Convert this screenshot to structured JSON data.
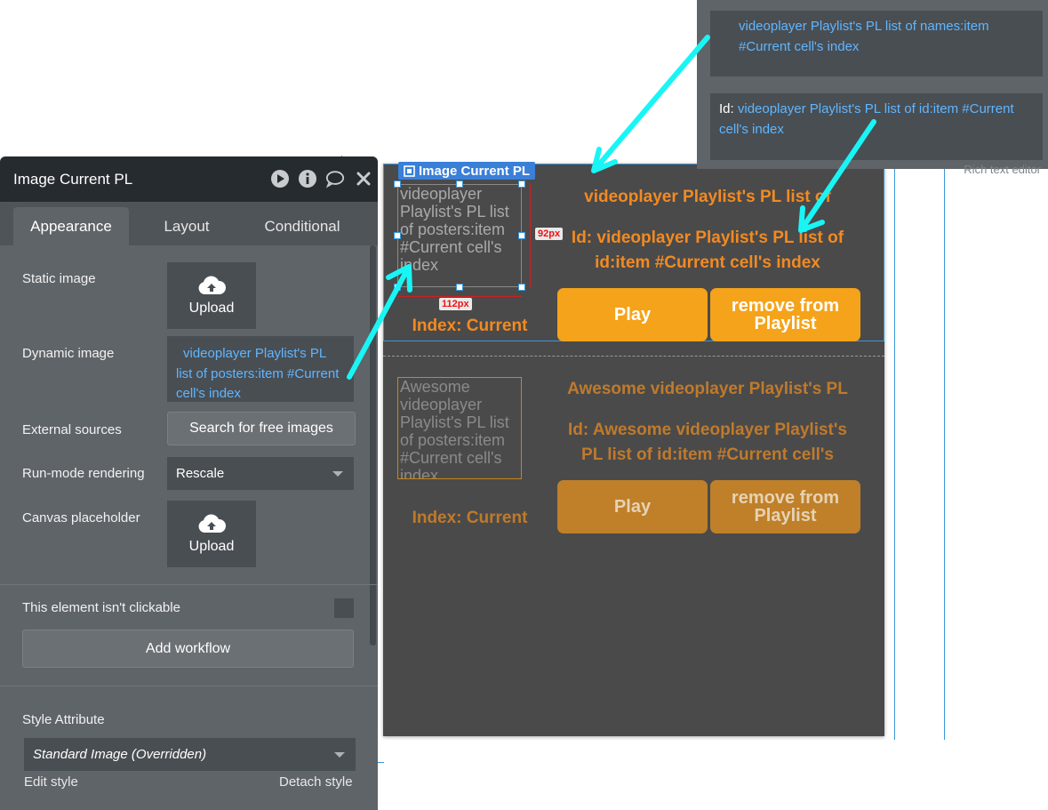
{
  "panel": {
    "title": "Image Current PL",
    "tabs": [
      "Appearance",
      "Layout",
      "Conditional"
    ],
    "active_tab": "Appearance",
    "static_image": {
      "label": "Static image",
      "button": "Upload"
    },
    "dynamic_image": {
      "label": "Dynamic image",
      "value": "videoplayer Playlist's PL list of posters:item #Current cell's index"
    },
    "external_sources": {
      "label": "External sources",
      "button": "Search for free images"
    },
    "run_mode": {
      "label": "Run-mode rendering",
      "value": "Rescale"
    },
    "canvas_placeholder": {
      "label": "Canvas placeholder",
      "button": "Upload"
    },
    "not_clickable": {
      "label": "This element isn't clickable",
      "checked": false
    },
    "add_workflow": "Add workflow",
    "style": {
      "label": "Style Attribute",
      "value": "Standard Image (Overridden)",
      "edit": "Edit style",
      "detach": "Detach style"
    }
  },
  "rich_text_editor": {
    "names_value": "videoplayer Playlist's PL list of names:item #Current cell's index",
    "id_prefix": "Id:",
    "id_value": "videoplayer Playlist's PL list of id:item #Current cell's index",
    "footer": "Rich text editor"
  },
  "canvas": {
    "selected_badge": "Image Current PL",
    "width_badge": "112px",
    "height_badge": "92px",
    "cell1": {
      "image_text": "videoplayer Playlist's PL list of posters:item #Current cell's index",
      "name": "videoplayer Playlist's PL list of",
      "id_line1": "Id: videoplayer Playlist's PL list of",
      "id_line2": "id:item #Current cell's index",
      "index": "Index: Current",
      "play": "Play",
      "remove": "remove from Playlist"
    },
    "cell2": {
      "image_text": "Awesome videoplayer Playlist's PL list of posters:item #Current cell's index",
      "name": "Awesome videoplayer Playlist's PL",
      "id_line1": "Id: Awesome videoplayer Playlist's",
      "id_line2": "PL list of id:item #Current cell's",
      "index": "Index: Current",
      "play": "Play",
      "remove": "remove from Playlist"
    }
  },
  "colors": {
    "accent_orange": "#f5a31a",
    "text_orange": "#f28a22",
    "link_blue": "#5fb6ff",
    "annotation_arrow": "#19f5f5",
    "selection_blue": "#3a96d8"
  }
}
